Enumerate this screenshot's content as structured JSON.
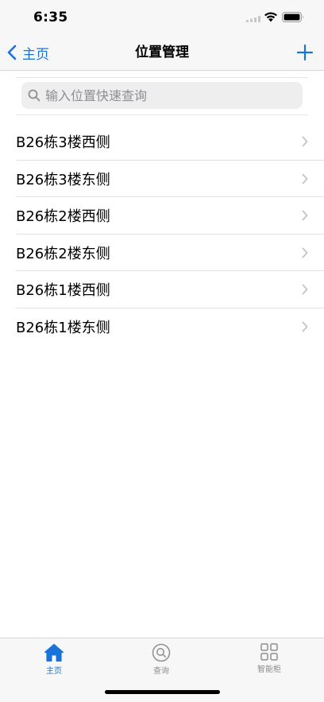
{
  "status_bar": {
    "time": "6:35",
    "icons": [
      "signal-icon",
      "wifi-icon",
      "battery-icon"
    ]
  },
  "nav": {
    "back_label": "主页",
    "title": "位置管理",
    "add_icon": "plus-icon"
  },
  "search": {
    "placeholder": "输入位置快速查询",
    "value": ""
  },
  "locations": [
    {
      "label": "B26栋3楼西侧"
    },
    {
      "label": "B26栋3楼东侧"
    },
    {
      "label": "B26栋2楼西侧"
    },
    {
      "label": "B26栋2楼东侧"
    },
    {
      "label": "B26栋1楼西侧"
    },
    {
      "label": "B26栋1楼东侧"
    }
  ],
  "tab_bar": {
    "tabs": [
      {
        "label": "主页",
        "icon": "home-icon",
        "active": true
      },
      {
        "label": "查询",
        "icon": "search-circle-icon",
        "active": false
      },
      {
        "label": "智能柜",
        "icon": "grid-icon",
        "active": false
      }
    ]
  },
  "colors": {
    "accent": "#1a73d9",
    "inactive": "#8e8e93",
    "bar_background": "#f7f7f7"
  }
}
